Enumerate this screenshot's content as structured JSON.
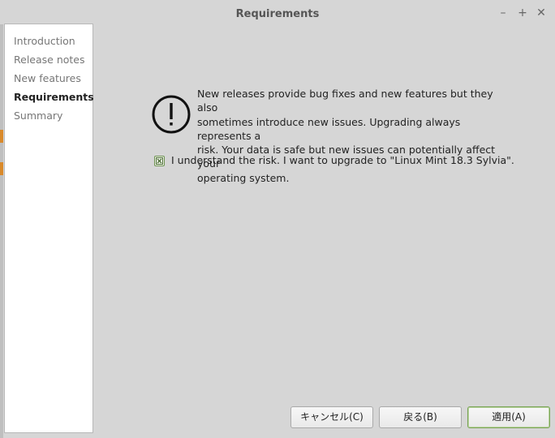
{
  "window": {
    "title": "Requirements",
    "controls": {
      "minimize": "–",
      "maximize": "+",
      "close": "✕"
    }
  },
  "sidebar": {
    "items": [
      {
        "label": "Introduction",
        "active": false
      },
      {
        "label": "Release notes",
        "active": false
      },
      {
        "label": "New features",
        "active": false
      },
      {
        "label": "Requirements",
        "active": true
      },
      {
        "label": "Summary",
        "active": false
      }
    ]
  },
  "main": {
    "icon": "warning-exclamation-icon",
    "message_lines": [
      "New releases provide bug fixes and new features but they also",
      "sometimes introduce new issues. Upgrading always represents a",
      "risk. Your data is safe but new issues can potentially affect your",
      "operating system."
    ],
    "checkbox": {
      "checked": true,
      "label": "I understand the risk. I want to upgrade to \"Linux Mint 18.3 Sylvia\"."
    }
  },
  "buttons": {
    "cancel": "キャンセル(C)",
    "back": "戻る(B)",
    "apply": "適用(A)"
  },
  "colors": {
    "checkbox_accent": "#6a8f4d",
    "primary_button_border": "#7aa356"
  }
}
